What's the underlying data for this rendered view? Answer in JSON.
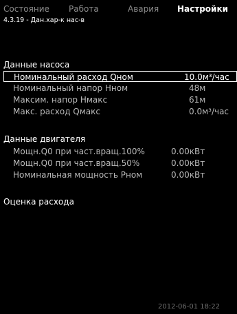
{
  "tabs": [
    {
      "label": "Состояние"
    },
    {
      "label": "Работа"
    },
    {
      "label": "Авария"
    },
    {
      "label": "Настройки"
    }
  ],
  "breadcrumb": "4.3.19 - Дан.хар-к нас-в",
  "pump_section": {
    "title": "Данные насоса",
    "rows": [
      {
        "label": "Номинальный расход Qном",
        "value": "10.0м³/час"
      },
      {
        "label": "Номинальный напор Нном",
        "value": "48м"
      },
      {
        "label": "Максим. напор Нмакс",
        "value": "61м"
      },
      {
        "label": "Макс. расход Qмакс",
        "value": "0.0м³/час"
      }
    ]
  },
  "motor_section": {
    "title": "Данные двигателя",
    "rows": [
      {
        "label": "Мощн.Q0 при част.вращ.100%",
        "value": "0.00кВт"
      },
      {
        "label": "Мощн.Q0 при част.вращ.50%",
        "value": "0.00кВт"
      },
      {
        "label": "Номинальная мощность Рном",
        "value": "0.00кВт"
      }
    ]
  },
  "flow_estimation": "Оценка расхода",
  "datetime": "2012-06-01 18:22"
}
